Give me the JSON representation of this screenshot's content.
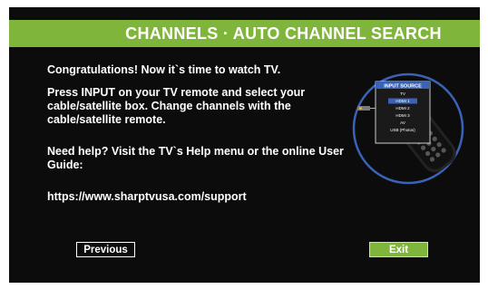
{
  "header": {
    "title": "CHANNELS · AUTO CHANNEL SEARCH"
  },
  "main": {
    "paragraphs": [
      "Congratulations! Now it`s time to watch TV.",
      "Press INPUT on your TV remote and select your cable/satellite box. Change channels with the cable/satellite remote.",
      "Need help? Visit the TV`s Help menu or the online User Guide:",
      "https://www.sharptvusa.com/support"
    ]
  },
  "input_source_menu": {
    "title": "INPUT SOURCE",
    "items": [
      "TV",
      "HDMI 1",
      "HDMI 2",
      "HDMI 3",
      "AV",
      "USB (Photos)"
    ],
    "selected": "HDMI 1"
  },
  "footer": {
    "previous_label": "Previous",
    "exit_label": "Exit"
  },
  "colors": {
    "accent": "#80b53b",
    "background": "#0c0c0c",
    "text": "#ffffff",
    "menu_highlight": "#3a63b8"
  },
  "icons": [
    "remote-control-icon",
    "cable-box-icon"
  ]
}
